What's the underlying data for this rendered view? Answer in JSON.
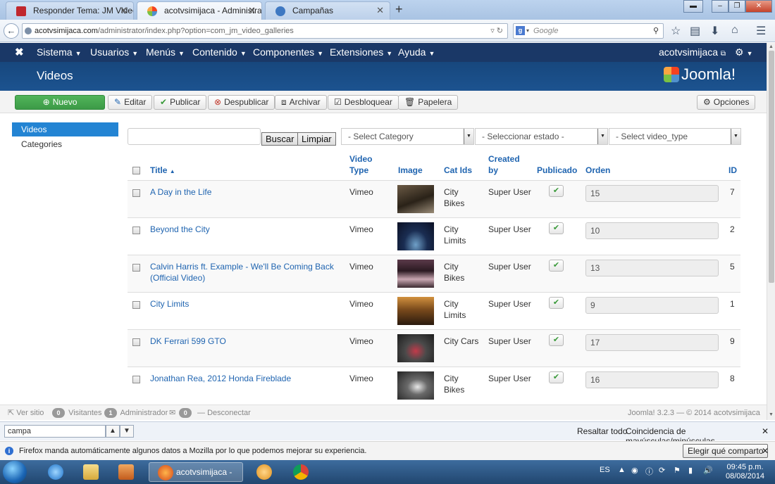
{
  "browser": {
    "tabs": [
      {
        "title": "Responder Tema: JM Video...",
        "active": false
      },
      {
        "title": "acotvsimijaca - Administra...",
        "active": true
      },
      {
        "title": "Campañas",
        "active": false
      }
    ],
    "new_tab": "+",
    "url_host": "acotvsimijaca.com",
    "url_path": "/administrator/index.php?option=com_jm_video_galleries",
    "search_placeholder": "Google"
  },
  "joomla": {
    "menu": [
      "Sistema",
      "Usuarios",
      "Menús",
      "Contenido",
      "Componentes",
      "Extensiones",
      "Ayuda"
    ],
    "site_user": "acotvsimijaca",
    "page_title": "Videos",
    "brand": "Joomla!",
    "toolbar": {
      "nuevo": "Nuevo",
      "editar": "Editar",
      "publicar": "Publicar",
      "despublicar": "Despublicar",
      "archivar": "Archivar",
      "desbloquear": "Desbloquear",
      "papelera": "Papelera",
      "opciones": "Opciones"
    },
    "sidebar": [
      {
        "label": "Videos",
        "active": true
      },
      {
        "label": "Categories",
        "active": false
      }
    ],
    "filters": {
      "search_value": "",
      "buscar": "Buscar",
      "limpiar": "Limpiar",
      "category": "- Select Category",
      "estado": "- Seleccionar estado -",
      "video_type": "- Select video_type"
    },
    "table": {
      "headers": {
        "title": "Title",
        "video_type": [
          "Video",
          "Type"
        ],
        "image": "Image",
        "cat_ids": "Cat Ids",
        "created_by": [
          "Created",
          "by"
        ],
        "publicado": "Publicado",
        "orden": "Orden",
        "id": "ID"
      },
      "rows": [
        {
          "title": [
            "A Day in the Life"
          ],
          "type": "Vimeo",
          "cat": [
            "City",
            "Bikes"
          ],
          "by": "Super User",
          "orden": "15",
          "id": "7"
        },
        {
          "title": [
            "Beyond the City"
          ],
          "type": "Vimeo",
          "cat": [
            "City",
            "Limits"
          ],
          "by": "Super User",
          "orden": "10",
          "id": "2"
        },
        {
          "title": [
            "Calvin Harris ft. Example - We'll Be Coming Back",
            "(Official Video)"
          ],
          "type": "Vimeo",
          "cat": [
            "City",
            "Bikes"
          ],
          "by": "Super User",
          "orden": "13",
          "id": "5"
        },
        {
          "title": [
            "City Limits"
          ],
          "type": "Vimeo",
          "cat": [
            "City",
            "Limits"
          ],
          "by": "Super User",
          "orden": "9",
          "id": "1"
        },
        {
          "title": [
            "DK Ferrari 599 GTO"
          ],
          "type": "Vimeo",
          "cat": [
            "City Cars"
          ],
          "by": "Super User",
          "orden": "17",
          "id": "9"
        },
        {
          "title": [
            "Jonathan Rea, 2012 Honda Fireblade"
          ],
          "type": "Vimeo",
          "cat": [
            "City",
            "Bikes"
          ],
          "by": "Super User",
          "orden": "16",
          "id": "8"
        }
      ]
    },
    "status": {
      "ver_sitio": "Ver sitio",
      "visitantes_count": "0",
      "visitantes": "Visitantes",
      "admin_count": "1",
      "admin": "Administrador",
      "msg_count": "0",
      "desconectar": "Desconectar",
      "version": "Joomla! 3.2.3 — © 2014 acotvsimijaca"
    }
  },
  "findbar": {
    "query": "campa",
    "highlight": "Resaltar todo",
    "match_case": "Coincidencia de mayúsculas/minúsculas"
  },
  "notification": {
    "text": "Firefox manda automáticamente algunos datos a Mozilla por lo que podemos mejorar su experiencia.",
    "button": "Elegir qué comparto"
  },
  "taskbar": {
    "active_app": "acotvsimijaca - A...",
    "lang": "ES",
    "time": "09:45 p.m.",
    "date": "08/08/2014"
  }
}
